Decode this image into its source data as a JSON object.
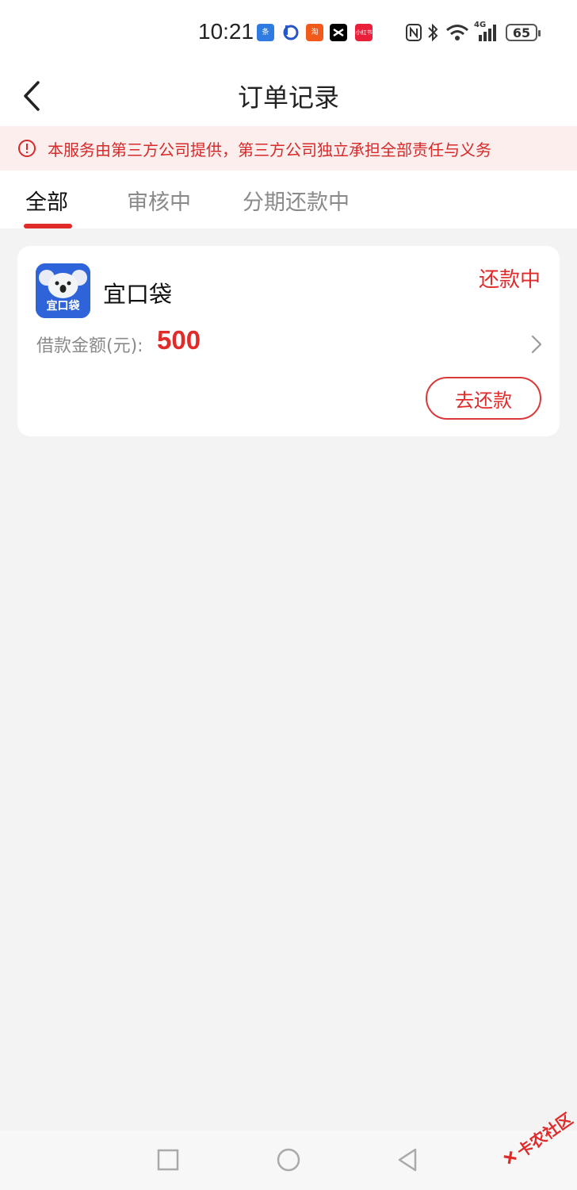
{
  "status_bar": {
    "time": "10:21",
    "battery": "65",
    "network": "4G",
    "notification_icons": [
      "toutiao-icon",
      "baidu-icon",
      "taobao-icon",
      "capcut-icon",
      "xiaohongshu-icon"
    ],
    "right_icons": [
      "nfc-icon",
      "bluetooth-icon",
      "wifi-icon",
      "signal-icon",
      "battery-icon"
    ]
  },
  "navbar": {
    "title": "订单记录",
    "back_icon": "chevron-left-icon"
  },
  "notice": {
    "text": "本服务由第三方公司提供，第三方公司独立承担全部责任与义务",
    "icon": "alert-circle-icon",
    "color": "#d52a2a"
  },
  "tabs": [
    {
      "label": "全部",
      "active": true
    },
    {
      "label": "审核中",
      "active": false
    },
    {
      "label": "分期还款中",
      "active": false
    }
  ],
  "orders": [
    {
      "app_name": "宜口袋",
      "logo_text": "宜口袋",
      "status": "还款中",
      "amount_label": "借款金额(元):",
      "amount": "500",
      "action_label": "去还款"
    }
  ],
  "bottom_nav": [
    "square-icon",
    "circle-icon",
    "triangle-back-icon"
  ],
  "watermark": {
    "text": "卡农社区"
  },
  "colors": {
    "accent": "#e02b2b",
    "background": "#f3f3f3",
    "notice_bg": "#fdeeee"
  }
}
